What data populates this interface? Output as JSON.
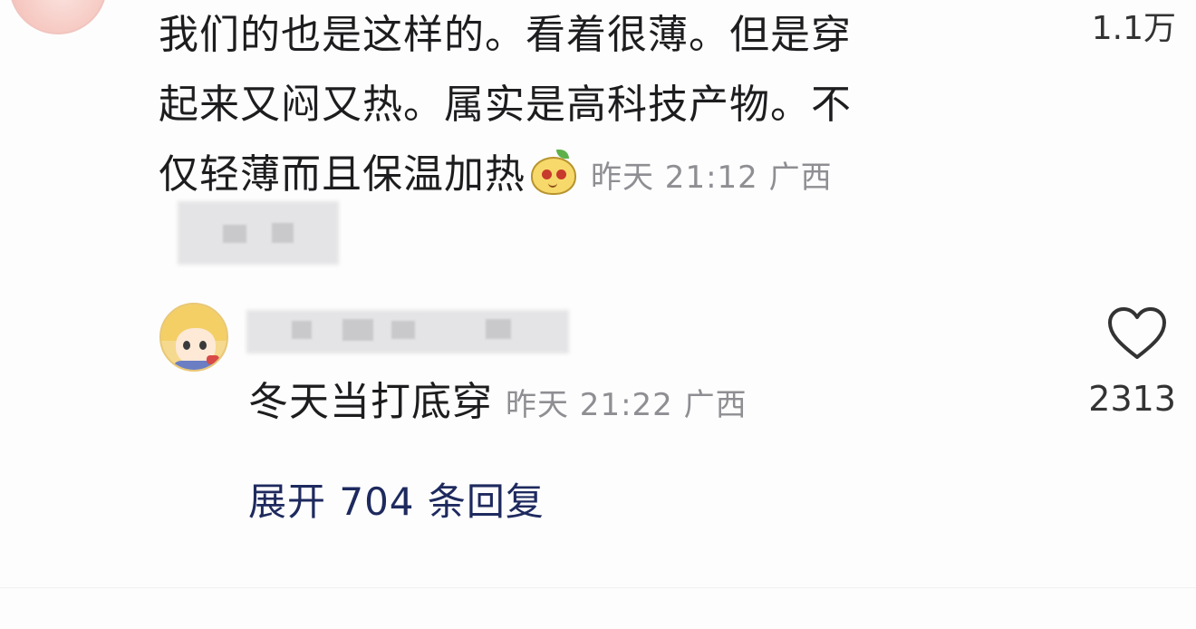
{
  "comment": {
    "lines": [
      "我们的也是这样的。看着很薄。但是穿",
      "起来又闷又热。属实是高科技产物。不",
      "仅轻薄而且保温加热"
    ],
    "emoji": "pear-face-emoji",
    "time": "昨天 21:12",
    "location": "广西",
    "likes": "1.1万"
  },
  "reply": {
    "text": "冬天当打底穿",
    "time": "昨天 21:22",
    "location": "广西",
    "likes": "2313",
    "like_icon": "heart-outline-icon"
  },
  "expand_label": "展开 704 条回复"
}
